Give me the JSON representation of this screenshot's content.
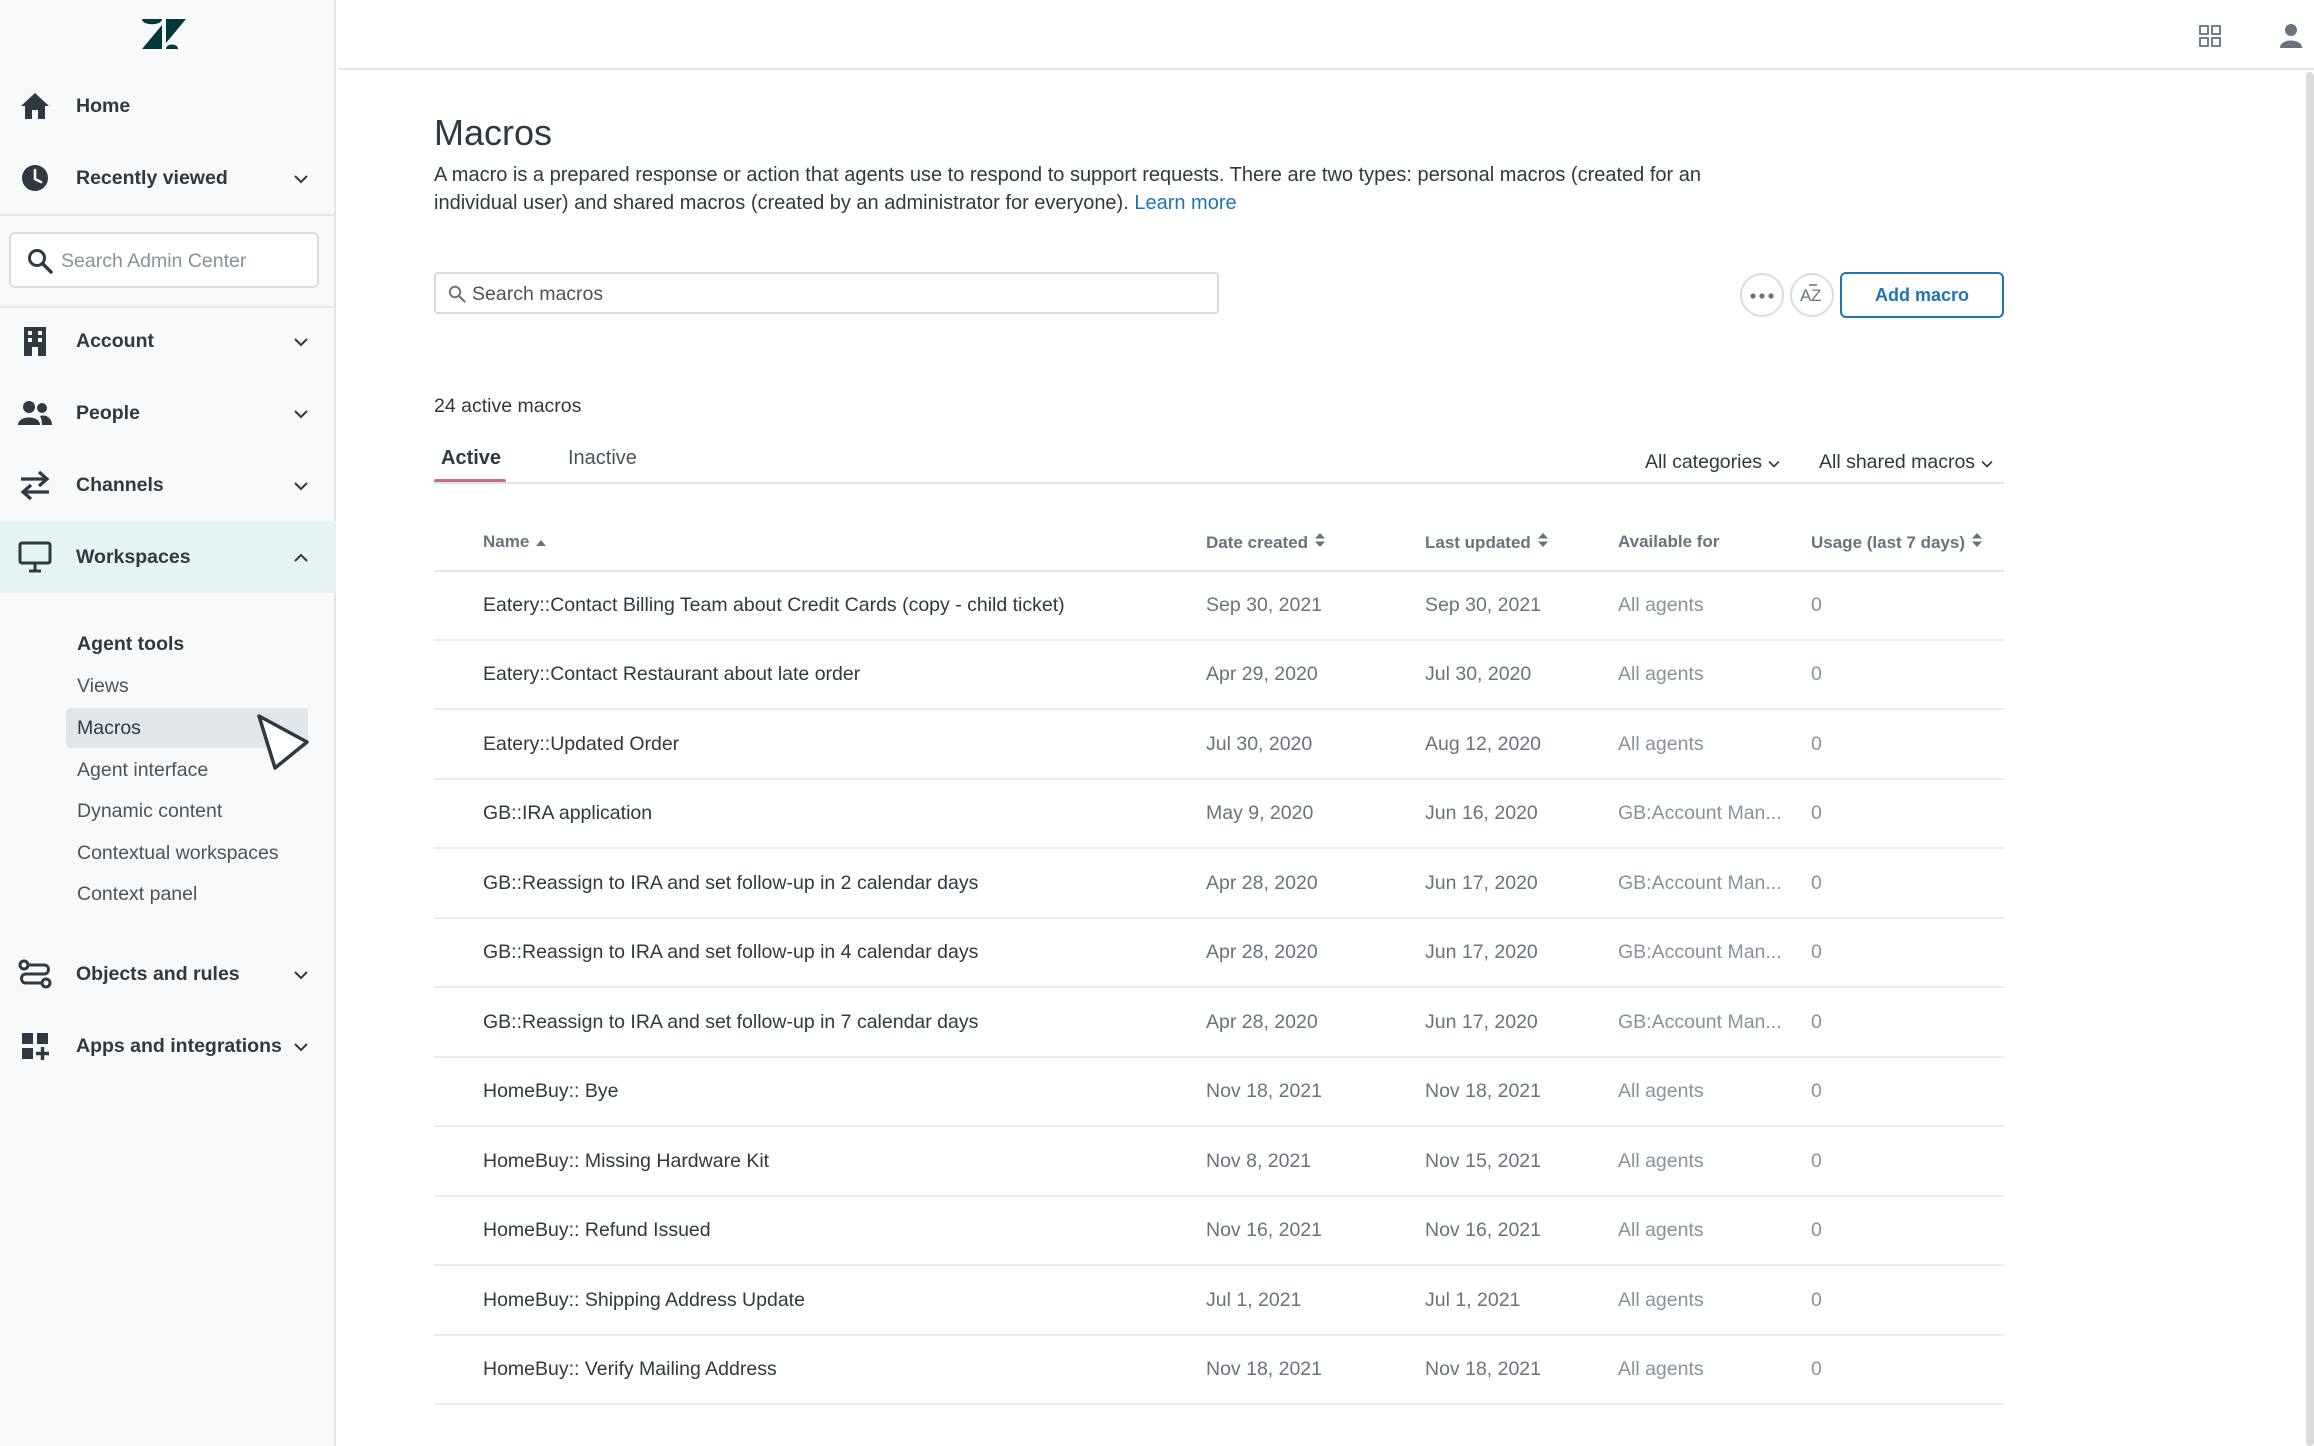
{
  "sidebar": {
    "logo": "zendesk-logo",
    "home": "Home",
    "recently_viewed": "Recently viewed",
    "search_placeholder": "Search Admin Center",
    "account": "Account",
    "people": "People",
    "channels": "Channels",
    "workspaces": "Workspaces",
    "subnav_heading": "Agent tools",
    "subnav": [
      "Views",
      "Macros",
      "Agent interface",
      "Dynamic content",
      "Contextual workspaces",
      "Context panel"
    ],
    "objects_rules": "Objects and rules",
    "apps_integrations": "Apps and integrations"
  },
  "topbar": {
    "apps_icon": "grid-icon",
    "user_icon": "user-icon"
  },
  "main": {
    "title": "Macros",
    "description": "A macro is a prepared response or action that agents use to respond to support requests. There are two types: personal macros (created for an individual user) and shared macros (created by an administrator for everyone).",
    "learn_more": "Learn more",
    "search_placeholder": "Search macros",
    "add_button": "Add macro",
    "count": "24 active macros",
    "tabs": [
      "Active",
      "Inactive"
    ],
    "filters": {
      "categories": "All categories",
      "shared": "All shared macros"
    }
  },
  "table": {
    "columns": [
      "Name",
      "Date created",
      "Last updated",
      "Available for",
      "Usage (last 7 days)"
    ],
    "rows": [
      {
        "name": "Eatery::Contact Billing Team about Credit Cards (copy - child ticket)",
        "created": "Sep 30, 2021",
        "updated": "Sep 30, 2021",
        "available": "All agents",
        "usage": "0"
      },
      {
        "name": "Eatery::Contact Restaurant about late order",
        "created": "Apr 29, 2020",
        "updated": "Jul 30, 2020",
        "available": "All agents",
        "usage": "0"
      },
      {
        "name": "Eatery::Updated Order",
        "created": "Jul 30, 2020",
        "updated": "Aug 12, 2020",
        "available": "All agents",
        "usage": "0"
      },
      {
        "name": "GB::IRA application",
        "created": "May 9, 2020",
        "updated": "Jun 16, 2020",
        "available": "GB:Account Man...",
        "usage": "0"
      },
      {
        "name": "GB::Reassign to IRA and set follow-up in 2 calendar days",
        "created": "Apr 28, 2020",
        "updated": "Jun 17, 2020",
        "available": "GB:Account Man...",
        "usage": "0"
      },
      {
        "name": "GB::Reassign to IRA and set follow-up in 4 calendar days",
        "created": "Apr 28, 2020",
        "updated": "Jun 17, 2020",
        "available": "GB:Account Man...",
        "usage": "0"
      },
      {
        "name": "GB::Reassign to IRA and set follow-up in 7 calendar days",
        "created": "Apr 28, 2020",
        "updated": "Jun 17, 2020",
        "available": "GB:Account Man...",
        "usage": "0"
      },
      {
        "name": "HomeBuy:: Bye",
        "created": "Nov 18, 2021",
        "updated": "Nov 18, 2021",
        "available": "All agents",
        "usage": "0"
      },
      {
        "name": "HomeBuy:: Missing Hardware Kit",
        "created": "Nov 8, 2021",
        "updated": "Nov 15, 2021",
        "available": "All agents",
        "usage": "0"
      },
      {
        "name": "HomeBuy:: Refund Issued",
        "created": "Nov 16, 2021",
        "updated": "Nov 16, 2021",
        "available": "All agents",
        "usage": "0"
      },
      {
        "name": "HomeBuy:: Shipping Address Update",
        "created": "Jul 1, 2021",
        "updated": "Jul 1, 2021",
        "available": "All agents",
        "usage": "0"
      },
      {
        "name": "HomeBuy:: Verify Mailing Address",
        "created": "Nov 18, 2021",
        "updated": "Nov 18, 2021",
        "available": "All agents",
        "usage": "0"
      }
    ]
  },
  "colors": {
    "accent": "#1f73b7",
    "active_tab": "#c4707c",
    "sidebar_active": "#e7f2f2"
  }
}
